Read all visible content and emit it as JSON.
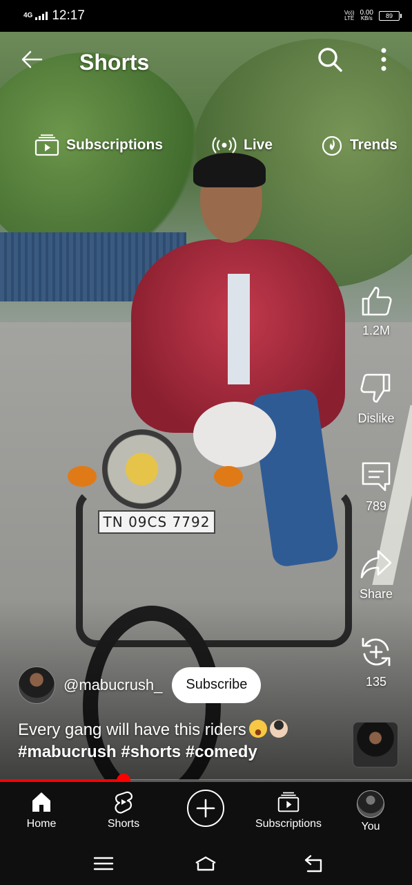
{
  "status_bar": {
    "network": "4G",
    "time": "12:17",
    "volte": "Vo))",
    "lte": "LTE",
    "speed_value": "0.00",
    "speed_unit": "KB/s",
    "battery": "89"
  },
  "header": {
    "title": "Shorts",
    "back_icon": "arrow-left-icon",
    "search_icon": "search-icon",
    "more_icon": "more-vertical-icon"
  },
  "chips": [
    {
      "label": "Subscriptions",
      "icon": "subscriptions-icon"
    },
    {
      "label": "Live",
      "icon": "live-icon"
    },
    {
      "label": "Trends",
      "icon": "trends-icon"
    }
  ],
  "actions": {
    "like": {
      "label": "1.2M",
      "icon": "thumbs-up-icon"
    },
    "dislike": {
      "label": "Dislike",
      "icon": "thumbs-down-icon"
    },
    "comments": {
      "label": "789",
      "icon": "comment-icon"
    },
    "share": {
      "label": "Share",
      "icon": "share-icon"
    },
    "remix": {
      "label": "135",
      "icon": "remix-icon"
    }
  },
  "channel": {
    "handle": "@mabucrush_",
    "subscribe_label": "Subscribe"
  },
  "caption": {
    "text": "Every gang will have this riders",
    "tags": "#mabucrush #shorts #comedy"
  },
  "video": {
    "plate": "TN 09CS 7792",
    "progress": 0.3
  },
  "bottom_nav": [
    {
      "label": "Home",
      "icon": "home-icon"
    },
    {
      "label": "Shorts",
      "icon": "shorts-icon"
    },
    {
      "label": "",
      "icon": "create-icon"
    },
    {
      "label": "Subscriptions",
      "icon": "subscriptions-icon"
    },
    {
      "label": "You",
      "icon": "avatar"
    }
  ],
  "colors": {
    "accent": "#ff0000",
    "nav_bg": "#0f0f0f",
    "subscribe_bg": "#ffffff"
  }
}
